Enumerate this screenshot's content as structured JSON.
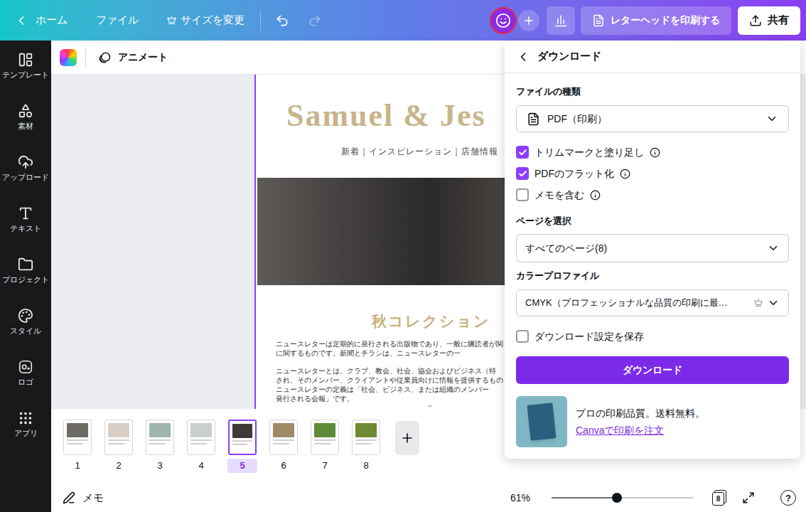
{
  "topbar": {
    "home": "ホーム",
    "file": "ファイル",
    "resize": "サイズを変更",
    "undo_disabled": false,
    "redo_disabled": true,
    "print_button": "レターヘッドを印刷する",
    "share": "共有"
  },
  "sidebar": {
    "items": [
      {
        "label": "テンプレート"
      },
      {
        "label": "素材"
      },
      {
        "label": "アップロード"
      },
      {
        "label": "テキスト"
      },
      {
        "label": "プロジェクト"
      },
      {
        "label": "スタイル"
      },
      {
        "label": "ロゴ"
      },
      {
        "label": "アプリ"
      }
    ]
  },
  "toolbar": {
    "animate": "アニメート"
  },
  "document": {
    "title": "Samuel & Jes",
    "nav": "新着｜インスピレーション｜店舗情報",
    "heading": "秋コレクション",
    "body": [
      [
        "ニュースレターは定期的に発行される出版物であり、一般に購読者が関",
        "に関するものです。新聞とチラシは、ニュースレターの一"
      ],
      [
        "ニュースレターとは、クラブ、教会、社会、協会およびビジネス（特",
        "され、そのメンバー、クライアントや従業員向けに情報を提供するもの",
        "ニュースレターの定義は「社会、ビジネス、または組織のメンバー",
        "発行される会報」です。"
      ]
    ]
  },
  "pages": [
    {
      "number": "1",
      "selected": false
    },
    {
      "number": "2",
      "selected": false
    },
    {
      "number": "3",
      "selected": false
    },
    {
      "number": "4",
      "selected": false
    },
    {
      "number": "5",
      "selected": true
    },
    {
      "number": "6",
      "selected": false
    },
    {
      "number": "7",
      "selected": false
    },
    {
      "number": "8",
      "selected": false
    }
  ],
  "bottom_bar": {
    "notes": "メモ",
    "zoom": "61%",
    "zoom_level": 0.46,
    "page_count": "8",
    "help": "?"
  },
  "download": {
    "title": "ダウンロード",
    "file_type_label": "ファイルの種類",
    "file_type": "PDF（印刷）",
    "options": [
      {
        "label": "トリムマークと塗り足し",
        "checked": true
      },
      {
        "label": "PDFのフラット化",
        "checked": true
      },
      {
        "label": "メモを含む",
        "checked": false
      }
    ],
    "pages_label": "ページを選択",
    "pages": "すべてのページ(8)",
    "color_profile_label": "カラープロファイル",
    "color_profile": "CMYK（プロフェッショナルな品質の印刷に最…",
    "save_settings": {
      "label": "ダウンロード設定を保存",
      "checked": false
    },
    "button": "ダウンロード",
    "promo": {
      "text": "プロの印刷品質。送料無料。",
      "link": "Canvaで印刷を注文"
    }
  }
}
